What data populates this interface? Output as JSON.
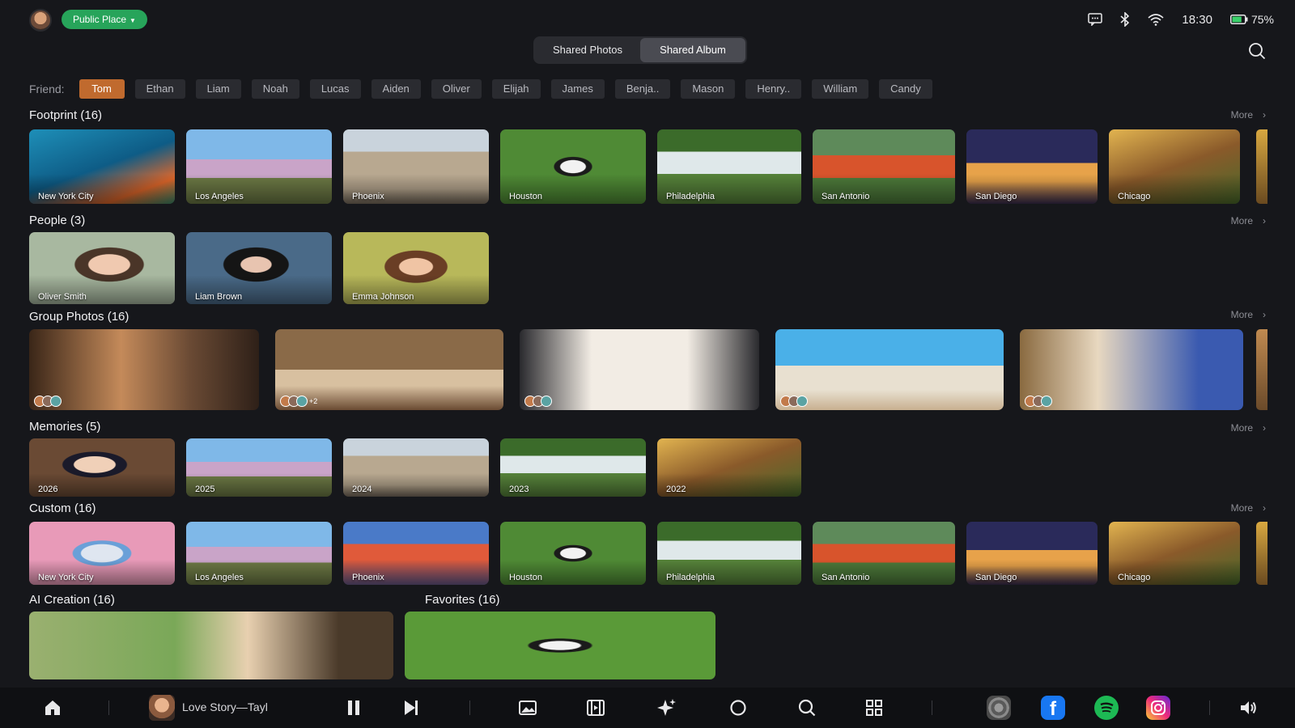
{
  "status": {
    "place": "Public Place",
    "time": "18:30",
    "battery": "75%",
    "battery_level": 0.75
  },
  "tabs": [
    {
      "label": "Shared Photos",
      "active": false
    },
    {
      "label": "Shared Album",
      "active": true
    }
  ],
  "friends": {
    "label": "Friend:",
    "items": [
      "Tom",
      "Ethan",
      "Liam",
      "Noah",
      "Lucas",
      "Aiden",
      "Oliver",
      "Elijah",
      "James",
      "Benja..",
      "Mason",
      "Henry..",
      "William",
      "Candy"
    ],
    "active": "Tom"
  },
  "more_label": "More",
  "sections": {
    "footprint": {
      "title": "Footprint (16)",
      "items": [
        "New York City",
        "Los Angeles",
        "Phoenix",
        "Houston",
        "Philadelphia",
        "San Antonio",
        "San Diego",
        "Chicago"
      ]
    },
    "people": {
      "title": "People (3)",
      "items": [
        "Oliver Smith",
        "Liam Brown",
        "Emma Johnson"
      ]
    },
    "group": {
      "title": "Group Photos (16)",
      "extra_count": "+2"
    },
    "memories": {
      "title": "Memories (5)",
      "items": [
        "2026",
        "2025",
        "2024",
        "2023",
        "2022"
      ]
    },
    "custom": {
      "title": "Custom (16)",
      "items": [
        "New York City",
        "Los Angeles",
        "Phoenix",
        "Houston",
        "Philadelphia",
        "San Antonio",
        "San Diego",
        "Chicago"
      ]
    },
    "ai": {
      "title": "AI Creation (16)"
    },
    "favorites": {
      "title": "Favorites (16)"
    }
  },
  "now_playing": {
    "title": "Love Story—Tayl"
  },
  "colors": {
    "accent_chip": "#c06a2e",
    "place_pill": "#27a45a",
    "background": "#16171b"
  }
}
